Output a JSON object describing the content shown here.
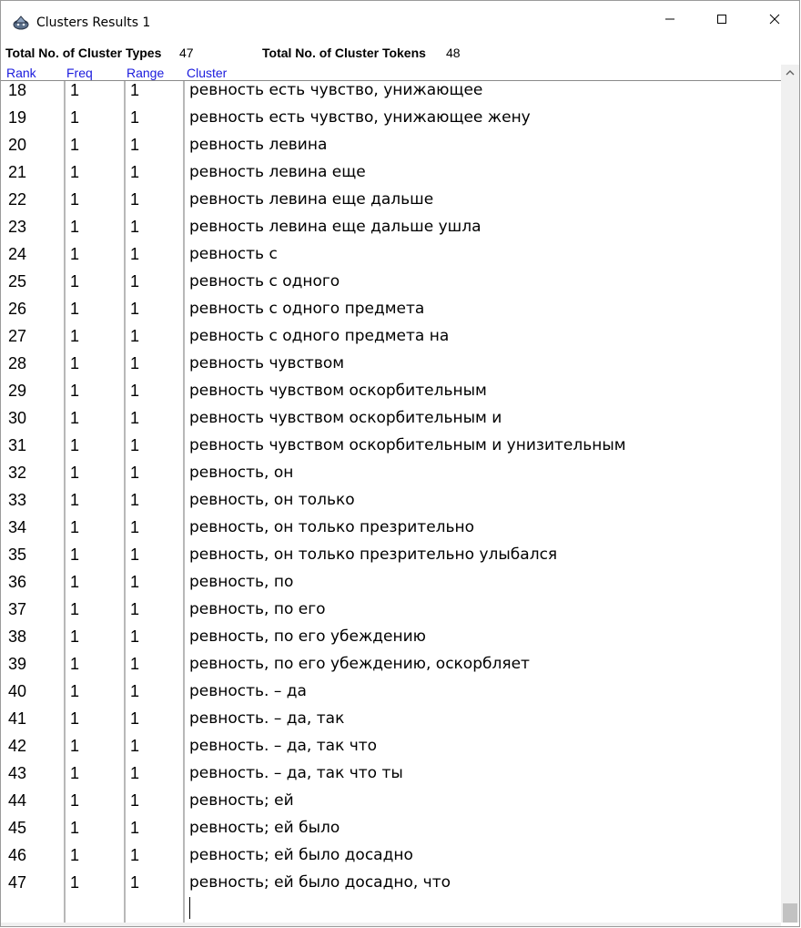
{
  "window": {
    "title": "Clusters Results 1",
    "app_icon": "rocket-icon",
    "controls": {
      "minimize": "minimize-icon",
      "maximize": "maximize-icon",
      "close": "close-icon"
    }
  },
  "stats": {
    "types_label": "Total No. of Cluster Types",
    "types_value": "47",
    "tokens_label": "Total No. of Cluster Tokens",
    "tokens_value": "48"
  },
  "columns": {
    "rank": "Rank",
    "freq": "Freq",
    "range": "Range",
    "cluster": "Cluster"
  },
  "header_color": "#1a1add",
  "rows": [
    {
      "rank": "18",
      "freq": "1",
      "range": "1",
      "cluster": "ревность есть чувство, унижающее"
    },
    {
      "rank": "19",
      "freq": "1",
      "range": "1",
      "cluster": "ревность есть чувство, унижающее жену"
    },
    {
      "rank": "20",
      "freq": "1",
      "range": "1",
      "cluster": "ревность левина"
    },
    {
      "rank": "21",
      "freq": "1",
      "range": "1",
      "cluster": "ревность левина еще"
    },
    {
      "rank": "22",
      "freq": "1",
      "range": "1",
      "cluster": "ревность левина еще дальше"
    },
    {
      "rank": "23",
      "freq": "1",
      "range": "1",
      "cluster": "ревность левина еще дальше ушла"
    },
    {
      "rank": "24",
      "freq": "1",
      "range": "1",
      "cluster": "ревность с"
    },
    {
      "rank": "25",
      "freq": "1",
      "range": "1",
      "cluster": "ревность с одного"
    },
    {
      "rank": "26",
      "freq": "1",
      "range": "1",
      "cluster": "ревность с одного предмета"
    },
    {
      "rank": "27",
      "freq": "1",
      "range": "1",
      "cluster": "ревность с одного предмета на"
    },
    {
      "rank": "28",
      "freq": "1",
      "range": "1",
      "cluster": "ревность чувством"
    },
    {
      "rank": "29",
      "freq": "1",
      "range": "1",
      "cluster": "ревность чувством оскорбительным"
    },
    {
      "rank": "30",
      "freq": "1",
      "range": "1",
      "cluster": "ревность чувством оскорбительным и"
    },
    {
      "rank": "31",
      "freq": "1",
      "range": "1",
      "cluster": "ревность чувством оскорбительным и унизительным"
    },
    {
      "rank": "32",
      "freq": "1",
      "range": "1",
      "cluster": "ревность, он"
    },
    {
      "rank": "33",
      "freq": "1",
      "range": "1",
      "cluster": "ревность, он только"
    },
    {
      "rank": "34",
      "freq": "1",
      "range": "1",
      "cluster": "ревность, он только презрительно"
    },
    {
      "rank": "35",
      "freq": "1",
      "range": "1",
      "cluster": "ревность, он только презрительно улыбался"
    },
    {
      "rank": "36",
      "freq": "1",
      "range": "1",
      "cluster": "ревность, по"
    },
    {
      "rank": "37",
      "freq": "1",
      "range": "1",
      "cluster": "ревность, по его"
    },
    {
      "rank": "38",
      "freq": "1",
      "range": "1",
      "cluster": "ревность, по его убеждению"
    },
    {
      "rank": "39",
      "freq": "1",
      "range": "1",
      "cluster": "ревность, по его убеждению, оскорбляет"
    },
    {
      "rank": "40",
      "freq": "1",
      "range": "1",
      "cluster": "ревность. – да"
    },
    {
      "rank": "41",
      "freq": "1",
      "range": "1",
      "cluster": "ревность. – да, так"
    },
    {
      "rank": "42",
      "freq": "1",
      "range": "1",
      "cluster": "ревность. – да, так что"
    },
    {
      "rank": "43",
      "freq": "1",
      "range": "1",
      "cluster": "ревность. – да, так что ты"
    },
    {
      "rank": "44",
      "freq": "1",
      "range": "1",
      "cluster": "ревность; ей"
    },
    {
      "rank": "45",
      "freq": "1",
      "range": "1",
      "cluster": "ревность; ей было"
    },
    {
      "rank": "46",
      "freq": "1",
      "range": "1",
      "cluster": "ревность; ей было досадно"
    },
    {
      "rank": "47",
      "freq": "1",
      "range": "1",
      "cluster": "ревность; ей было досадно, что"
    }
  ]
}
